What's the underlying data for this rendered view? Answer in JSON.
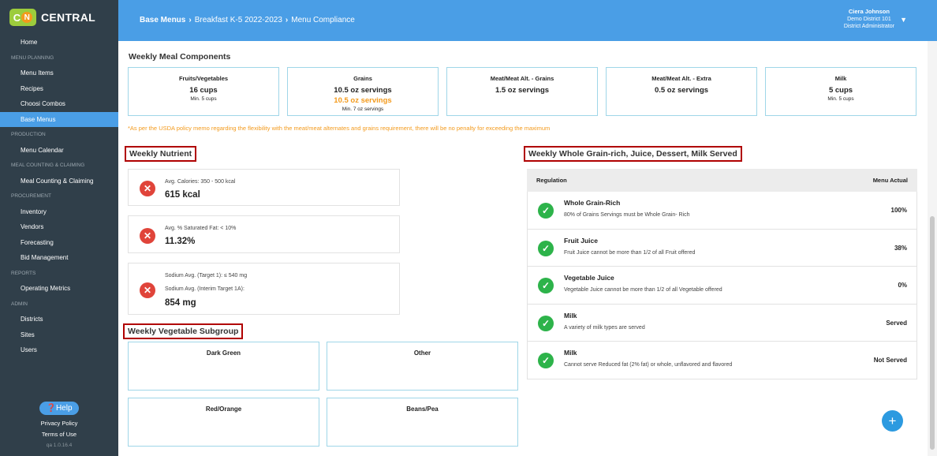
{
  "logo": {
    "letters": "CN",
    "text": "CENTRAL"
  },
  "nav": {
    "items": [
      {
        "type": "item",
        "label": "Home"
      },
      {
        "type": "section",
        "label": "MENU PLANNING"
      },
      {
        "type": "item",
        "label": "Menu Items"
      },
      {
        "type": "item",
        "label": "Recipes"
      },
      {
        "type": "item",
        "label": "Choosi Combos"
      },
      {
        "type": "item",
        "label": "Base Menus",
        "active": true
      },
      {
        "type": "section",
        "label": "PRODUCTION"
      },
      {
        "type": "item",
        "label": "Menu Calendar"
      },
      {
        "type": "section",
        "label": "MEAL COUNTING & CLAIMING"
      },
      {
        "type": "item",
        "label": "Meal Counting & Claiming"
      },
      {
        "type": "section",
        "label": "PROCUREMENT"
      },
      {
        "type": "item",
        "label": "Inventory"
      },
      {
        "type": "item",
        "label": "Vendors"
      },
      {
        "type": "item",
        "label": "Forecasting"
      },
      {
        "type": "item",
        "label": "Bid Management"
      },
      {
        "type": "section",
        "label": "REPORTS"
      },
      {
        "type": "item",
        "label": "Operating Metrics"
      },
      {
        "type": "section",
        "label": "ADMIN"
      },
      {
        "type": "item",
        "label": "Districts"
      },
      {
        "type": "item",
        "label": "Sites"
      },
      {
        "type": "item",
        "label": "Users"
      }
    ]
  },
  "footer": {
    "help": "Help",
    "privacy": "Privacy Policy",
    "terms": "Terms of Use",
    "version": "qa 1.0.16.4"
  },
  "breadcrumb": {
    "root": "Base Menus",
    "menu": "Breakfast K-5 2022-2023",
    "page": "Menu Compliance"
  },
  "user": {
    "name": "Ciera Johnson",
    "district": "Demo District 101",
    "role": "District Administrator"
  },
  "meal_components": {
    "heading": "Weekly Meal Components",
    "boxes": [
      {
        "title": "Fruits/Vegetables",
        "value": "16 cups",
        "min": "Min. 5 cups"
      },
      {
        "title": "Grains",
        "value": "10.5 oz servings",
        "value2": "10.5 oz servings",
        "min": "Min. 7 oz servings"
      },
      {
        "title": "Meat/Meat Alt. - Grains",
        "value": "1.5 oz servings"
      },
      {
        "title": "Meat/Meat Alt. - Extra",
        "value": "0.5 oz servings"
      },
      {
        "title": "Milk",
        "value": "5 cups",
        "min": "Min. 5 cups"
      }
    ],
    "memo": "*As per the USDA policy memo regarding the flexibility with the meat/meat alternates and grains requirement, there will be no penalty for exceeding the maximum"
  },
  "nutrient": {
    "heading": "Weekly Nutrient",
    "calories": {
      "label": "Avg. Calories: 350 - 500 kcal",
      "value": "615 kcal"
    },
    "sat_fat": {
      "label": "Avg. % Saturated Fat: < 10%",
      "value": "11.32%"
    },
    "sodium": {
      "label1": "Sodium Avg. (Target 1): ≤ 540 mg",
      "label2": "Sodium Avg. (Interim Target 1A):",
      "value": "854 mg"
    }
  },
  "veg_subgroup": {
    "heading": "Weekly Vegetable Subgroup",
    "boxes": [
      "Dark Green",
      "Other",
      "Red/Orange",
      "Beans/Pea"
    ]
  },
  "whole_grain": {
    "heading": "Weekly Whole Grain-rich, Juice, Dessert, Milk Served",
    "col_regulation": "Regulation",
    "col_actual": "Menu Actual",
    "rows": [
      {
        "title": "Whole Grain-Rich",
        "desc": "80% of Grains Servings must be Whole Grain- Rich",
        "value": "100%"
      },
      {
        "title": "Fruit Juice",
        "desc": "Fruit Juice cannot be more than 1/2 of all Fruit offered",
        "value": "38%"
      },
      {
        "title": "Vegetable Juice",
        "desc": "Vegetable Juice cannot be more than 1/2 of all Vegetable offered",
        "value": "0%"
      },
      {
        "title": "Milk",
        "desc": "A variety of milk types are served",
        "value": "Served"
      },
      {
        "title": "Milk",
        "desc": "Cannot serve Reduced fat (2% fat) or whole, unflavored and flavored",
        "value": "Not Served"
      }
    ]
  },
  "colors": {
    "sidebar": "#303f4a",
    "topbar": "#4a9ee6",
    "warning": "#f39a1c",
    "fail": "#e0443a",
    "pass": "#2db34a",
    "highlight_border": "#b00000"
  }
}
